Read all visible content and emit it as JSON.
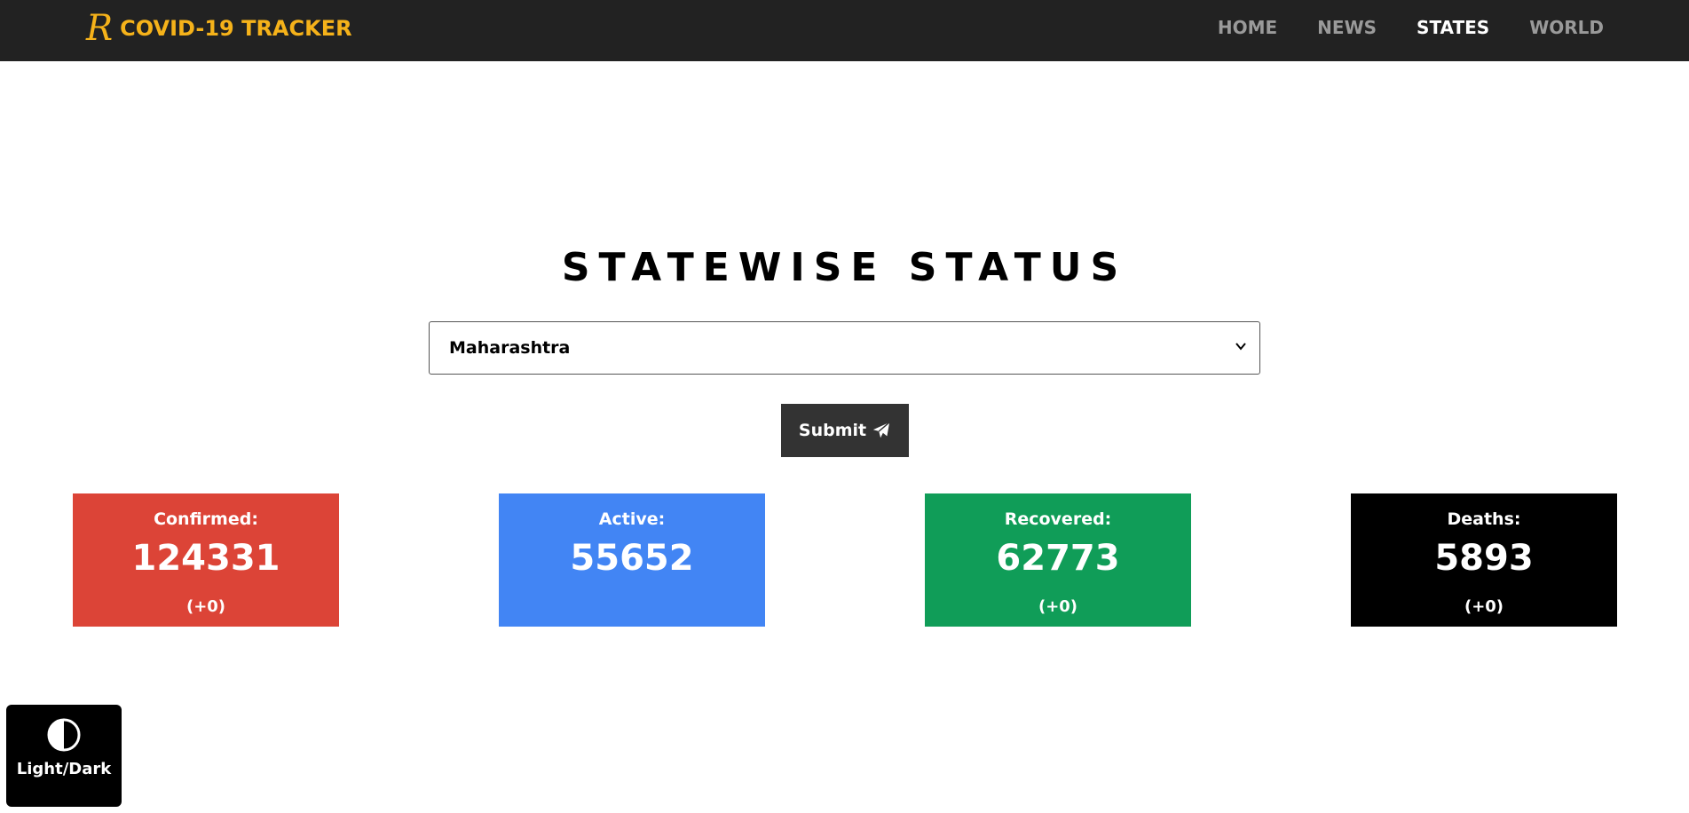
{
  "navbar": {
    "brand_logo": "R",
    "brand_text": "COVID-19 TRACKER",
    "links": [
      {
        "label": "HOME",
        "active": false
      },
      {
        "label": "NEWS",
        "active": false
      },
      {
        "label": "STATES",
        "active": true
      },
      {
        "label": "WORLD",
        "active": false
      }
    ]
  },
  "main": {
    "title": "STATEWISE STATUS",
    "state_select": {
      "selected": "Maharashtra"
    },
    "submit_label": "Submit",
    "submit_icon": "paper-plane-icon"
  },
  "stats": {
    "confirmed": {
      "label": "Confirmed:",
      "value": "124331",
      "delta": "(+0)",
      "color": "#dc4437"
    },
    "active": {
      "label": "Active:",
      "value": "55652",
      "color": "#4285f4"
    },
    "recovered": {
      "label": "Recovered:",
      "value": "62773",
      "delta": "(+0)",
      "color": "#109d58"
    },
    "deaths": {
      "label": "Deaths:",
      "value": "5893",
      "delta": "(+0)",
      "color": "#000000"
    }
  },
  "theme_toggle": {
    "label": "Light/Dark",
    "icon": "contrast-icon"
  },
  "colors": {
    "navbar_bg": "#222222",
    "brand": "#f5b21a",
    "nav_inactive": "#9a9a9a",
    "nav_active": "#ffffff"
  }
}
